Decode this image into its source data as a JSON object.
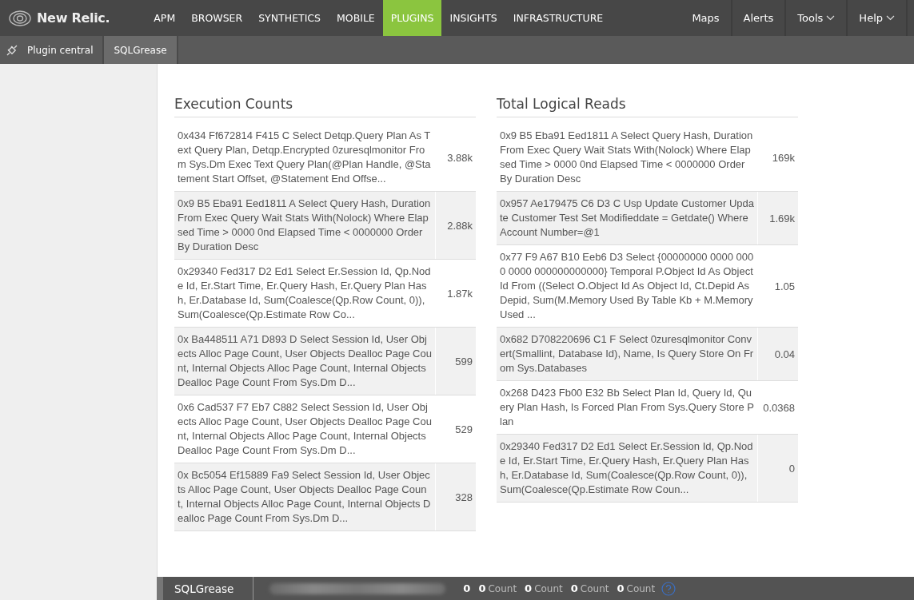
{
  "nav": {
    "logo": "New Relic.",
    "items": [
      {
        "label": "APM",
        "selected": false
      },
      {
        "label": "BROWSER",
        "selected": false
      },
      {
        "label": "SYNTHETICS",
        "selected": false
      },
      {
        "label": "MOBILE",
        "selected": false
      },
      {
        "label": "PLUGINS",
        "selected": true
      },
      {
        "label": "INSIGHTS",
        "selected": false
      },
      {
        "label": "INFRASTRUCTURE",
        "selected": false
      }
    ],
    "right": [
      {
        "label": "Maps",
        "dropdown": false
      },
      {
        "label": "Alerts",
        "dropdown": false
      },
      {
        "label": "Tools",
        "dropdown": true
      },
      {
        "label": "Help",
        "dropdown": true
      }
    ]
  },
  "subnav": [
    {
      "label": "Plugin central",
      "selected": false
    },
    {
      "label": "SQLGrease",
      "selected": true
    }
  ],
  "panels": [
    {
      "title": "Execution Counts",
      "rows": [
        {
          "query": "0x434 Ff672814 F415 C Select Detqp.Query Plan As Text Query Plan, Detqp.Encrypted 0zuresqlmonitor From Sys.Dm Exec Text Query Plan(@Plan Handle, @Statement Start Offset, @Statement End Offse...",
          "value": "3.88k"
        },
        {
          "query": "0x9 B5 Eba91 Eed1811 A Select Query Hash, Duration From Exec Query Wait Stats With(Nolock) Where Elapsed Time > 0000 0nd Elapsed Time < 0000000 Order By Duration Desc",
          "value": "2.88k"
        },
        {
          "query": "0x29340 Fed317 D2 Ed1 Select Er.Session Id, Qp.Node Id, Er.Start Time, Er.Query Hash, Er.Query Plan Hash, Er.Database Id, Sum(Coalesce(Qp.Row Count, 0)), Sum(Coalesce(Qp.Estimate Row Co...",
          "value": "1.87k"
        },
        {
          "query": "0x Ba448511 A71 D893 D Select Session Id, User Objects Alloc Page Count, User Objects Dealloc Page Count, Internal Objects Alloc Page Count, Internal Objects Dealloc Page Count From Sys.Dm D...",
          "value": "599"
        },
        {
          "query": "0x6 Cad537 F7 Eb7 C882 Select Session Id, User Objects Alloc Page Count, User Objects Dealloc Page Count, Internal Objects Alloc Page Count, Internal Objects Dealloc Page Count From Sys.Dm D...",
          "value": "529"
        },
        {
          "query": "0x Bc5054 Ef15889 Fa9 Select Session Id, User Objects Alloc Page Count, User Objects Dealloc Page Count, Internal Objects Alloc Page Count, Internal Objects Dealloc Page Count From Sys.Dm D...",
          "value": "328"
        }
      ]
    },
    {
      "title": "Total Logical Reads",
      "rows": [
        {
          "query": "0x9 B5 Eba91 Eed1811 A Select Query Hash, Duration From Exec Query Wait Stats With(Nolock) Where Elapsed Time > 0000 0nd Elapsed Time < 0000000 Order By Duration Desc",
          "value": "169k"
        },
        {
          "query": "0x957 Ae179475 C6 D3 C Usp Update Customer Update Customer Test Set Modifieddate = Getdate() Where Account Number=@1",
          "value": "1.69k"
        },
        {
          "query": "0x77 F9 A67 B10 Eeb6 D3 Select {00000000 0000 0000 0000 000000000000} Temporal P.Object Id As Object Id From ((Select O.Object Id As Object Id, Ct.Depid As Depid, Sum(M.Memory Used By Table Kb + M.Memory Used ...",
          "value": "1.05"
        },
        {
          "query": "0x682 D708220696 C1 F Select 0zuresqlmonitor Convert(Smallint, Database Id), Name, Is Query Store On From Sys.Databases",
          "value": "0.04"
        },
        {
          "query": "0x268 D423 Fb00 E32 Bb Select Plan Id, Query Id, Query Plan Hash, Is Forced Plan From Sys.Query Store Plan",
          "value": "0.0368"
        },
        {
          "query": "0x29340 Fed317 D2 Ed1 Select Er.Session Id, Qp.Node Id, Er.Start Time, Er.Query Hash, Er.Query Plan Hash, Er.Database Id, Sum(Coalesce(Qp.Row Count, 0)), Sum(Coalesce(Qp.Estimate Row Coun...",
          "value": "0"
        }
      ]
    }
  ],
  "footer": {
    "title": "SQLGrease",
    "first_value": "0",
    "metrics": [
      {
        "value": "0",
        "unit": "Count"
      },
      {
        "value": "0",
        "unit": "Count"
      },
      {
        "value": "0",
        "unit": "Count"
      },
      {
        "value": "0",
        "unit": "Count"
      }
    ]
  }
}
